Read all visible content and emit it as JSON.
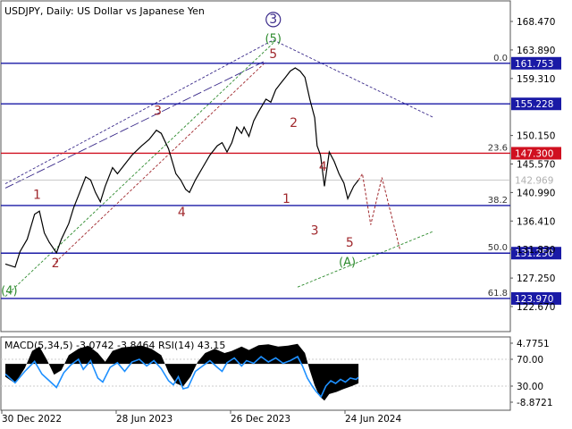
{
  "chart_data": {
    "type": "line",
    "title": "USDJPY, Daily:  US Dollar vs Japanese Yen",
    "symbol": "USDJPY",
    "timeframe": "Daily",
    "description": "US Dollar vs Japanese Yen",
    "x_ticks": [
      "30 Dec 2022",
      "28 Jun 2023",
      "26 Dec 2023",
      "24 Jun 2024"
    ],
    "y_ticks": [
      "168.470",
      "163.890",
      "159.310",
      "150.150",
      "145.570",
      "140.990",
      "136.410",
      "131.830",
      "127.250",
      "122.670"
    ],
    "ylim": [
      121.5,
      170.5
    ],
    "price_path": [
      [
        0.0,
        129.5
      ],
      [
        2.0,
        129.0
      ],
      [
        3.0,
        131.5
      ],
      [
        4.5,
        133.5
      ],
      [
        6.0,
        137.5
      ],
      [
        7.0,
        138.0
      ],
      [
        8.0,
        134.5
      ],
      [
        9.0,
        133.0
      ],
      [
        10.5,
        131.3
      ],
      [
        11.5,
        133.5
      ],
      [
        13.0,
        136.0
      ],
      [
        14.0,
        138.5
      ],
      [
        15.0,
        140.5
      ],
      [
        16.5,
        143.5
      ],
      [
        17.5,
        143.0
      ],
      [
        18.5,
        141.0
      ],
      [
        19.5,
        139.5
      ],
      [
        20.5,
        142.0
      ],
      [
        22.0,
        145.0
      ],
      [
        23.0,
        144.0
      ],
      [
        24.5,
        145.5
      ],
      [
        26.0,
        147.0
      ],
      [
        28.0,
        148.5
      ],
      [
        29.5,
        149.5
      ],
      [
        31.0,
        151.0
      ],
      [
        32.0,
        150.5
      ],
      [
        33.5,
        148.0
      ],
      [
        35.0,
        144.0
      ],
      [
        36.0,
        143.0
      ],
      [
        37.0,
        141.5
      ],
      [
        37.8,
        141.0
      ],
      [
        39.0,
        143.0
      ],
      [
        40.5,
        145.0
      ],
      [
        42.0,
        147.0
      ],
      [
        43.5,
        148.5
      ],
      [
        44.5,
        149.0
      ],
      [
        45.5,
        147.5
      ],
      [
        46.5,
        149.0
      ],
      [
        47.5,
        151.5
      ],
      [
        48.5,
        150.5
      ],
      [
        49.0,
        151.5
      ],
      [
        50.0,
        150.0
      ],
      [
        51.0,
        152.5
      ],
      [
        52.0,
        154.0
      ],
      [
        53.5,
        156.0
      ],
      [
        54.5,
        155.5
      ],
      [
        55.5,
        157.5
      ],
      [
        56.5,
        158.5
      ],
      [
        57.5,
        159.5
      ],
      [
        58.5,
        160.5
      ],
      [
        59.5,
        161.0
      ],
      [
        60.5,
        160.5
      ],
      [
        61.5,
        159.5
      ],
      [
        62.5,
        156.0
      ],
      [
        63.5,
        153.0
      ],
      [
        64.0,
        148.5
      ],
      [
        64.7,
        147.0
      ],
      [
        65.5,
        142.0
      ],
      [
        66.5,
        147.5
      ],
      [
        67.5,
        146.0
      ],
      [
        68.5,
        144.0
      ],
      [
        69.5,
        142.5
      ],
      [
        70.3,
        140.0
      ],
      [
        71.5,
        142.0
      ],
      [
        72.5,
        143.0
      ]
    ],
    "horizontal_levels": [
      {
        "price": 161.753,
        "label": "161.753",
        "fib": "0.0",
        "color": "#1a1aa6"
      },
      {
        "price": 155.228,
        "label": "155.228",
        "fib": "",
        "color": "#1a1aa6"
      },
      {
        "price": 147.3,
        "label": "147.300",
        "fib": "23.6",
        "color": "#d01020"
      },
      {
        "price": 142.969,
        "label": "142.969",
        "fib": "",
        "color": "#b8b8b8"
      },
      {
        "price": 138.9,
        "label": "",
        "fib": "38.2",
        "color": "#1a1aa6"
      },
      {
        "price": 131.25,
        "label": "131.250",
        "fib": "50.0",
        "color": "#1a1aa6"
      },
      {
        "price": 123.97,
        "label": "123.970",
        "fib": "61.8",
        "color": "#1a1aa6"
      }
    ],
    "wave_labels": [
      {
        "text": "(4)",
        "x": 0.8,
        "y": 124.6,
        "color": "#2e8b2e"
      },
      {
        "text": "1",
        "x": 6.5,
        "y": 140.0,
        "color": "#a0282d"
      },
      {
        "text": "2",
        "x": 10.3,
        "y": 129.0,
        "color": "#a0282d"
      },
      {
        "text": "3",
        "x": 31.3,
        "y": 153.5,
        "color": "#a0282d"
      },
      {
        "text": "4",
        "x": 36.2,
        "y": 137.2,
        "color": "#a0282d"
      },
      {
        "text": "5",
        "x": 55.0,
        "y": 162.6,
        "color": "#a0282d"
      },
      {
        "text": "(5)",
        "x": 55.0,
        "y": 165.1,
        "color": "#2e8b2e"
      },
      {
        "text": "3",
        "x": 55.0,
        "y": 168.2,
        "color": "#3a2a8a",
        "circled": true
      },
      {
        "text": "2",
        "x": 59.2,
        "y": 151.5,
        "color": "#a0282d"
      },
      {
        "text": "1",
        "x": 57.7,
        "y": 139.3,
        "color": "#a0282d"
      },
      {
        "text": "4",
        "x": 65.2,
        "y": 144.5,
        "color": "#a0282d"
      },
      {
        "text": "3",
        "x": 63.5,
        "y": 134.2,
        "color": "#a0282d"
      },
      {
        "text": "5",
        "x": 70.7,
        "y": 132.3,
        "color": "#a0282d"
      },
      {
        "text": "(A)",
        "x": 70.2,
        "y": 129.2,
        "color": "#2e8b2e"
      }
    ],
    "forecast_path": [
      [
        72.5,
        142.969
      ],
      [
        73.3,
        144.0
      ],
      [
        75.0,
        135.8
      ],
      [
        77.3,
        143.4
      ],
      [
        81.0,
        131.9
      ]
    ],
    "trend_lines": [
      {
        "from": [
          0.0,
          142.4
        ],
        "to": [
          55.0,
          165.5
        ],
        "color": "#3a2a8a",
        "dash": "3,2"
      },
      {
        "from": [
          0.0,
          141.7
        ],
        "to": [
          53.0,
          162.0
        ],
        "color": "#3a2a8a",
        "dash": "10,3"
      },
      {
        "from": [
          55.0,
          165.5
        ],
        "to": [
          88.0,
          153.0
        ],
        "color": "#3a2a8a",
        "dash": "3,2"
      },
      {
        "from": [
          0.0,
          124.3
        ],
        "to": [
          55.0,
          165.0
        ],
        "color": "#2e8b2e",
        "dash": "3,2"
      },
      {
        "from": [
          60.0,
          125.8
        ],
        "to": [
          88.0,
          134.8
        ],
        "color": "#2e8b2e",
        "dash": "3,2"
      },
      {
        "from": [
          10.3,
          129.8
        ],
        "to": [
          53.5,
          162.0
        ],
        "color": "#a0282d",
        "dash": "3,2"
      }
    ],
    "indicator": {
      "label": "MACD(5,34,5) -3.0742 -3.8464 RSI(14) 43.15",
      "name": "MACD(5,34,5)",
      "macd_main": -3.0742,
      "macd_signal": -3.8464,
      "rsi_period": 14,
      "rsi_value": 43.15,
      "y_ticks": [
        "4.7751",
        "70.00",
        "30.00",
        "-8.8721"
      ],
      "rsi_path": [
        [
          0.0,
          48
        ],
        [
          2.0,
          35
        ],
        [
          4.0,
          52
        ],
        [
          6.0,
          67
        ],
        [
          7.5,
          48
        ],
        [
          9.0,
          38
        ],
        [
          10.5,
          28
        ],
        [
          12.0,
          50
        ],
        [
          13.5,
          62
        ],
        [
          15.0,
          70
        ],
        [
          16.0,
          55
        ],
        [
          17.5,
          68
        ],
        [
          19.0,
          42
        ],
        [
          20.0,
          36
        ],
        [
          21.5,
          58
        ],
        [
          23.0,
          65
        ],
        [
          24.5,
          52
        ],
        [
          26.0,
          66
        ],
        [
          27.5,
          70
        ],
        [
          29.0,
          60
        ],
        [
          30.5,
          68
        ],
        [
          32.0,
          56
        ],
        [
          33.5,
          38
        ],
        [
          34.5,
          32
        ],
        [
          35.5,
          44
        ],
        [
          36.5,
          26
        ],
        [
          37.5,
          28
        ],
        [
          39.0,
          52
        ],
        [
          40.5,
          60
        ],
        [
          42.0,
          68
        ],
        [
          43.5,
          58
        ],
        [
          44.5,
          52
        ],
        [
          45.5,
          65
        ],
        [
          47.0,
          72
        ],
        [
          48.5,
          60
        ],
        [
          49.5,
          68
        ],
        [
          51.0,
          64
        ],
        [
          52.5,
          74
        ],
        [
          54.0,
          66
        ],
        [
          55.5,
          72
        ],
        [
          57.0,
          64
        ],
        [
          58.5,
          68
        ],
        [
          60.0,
          74
        ],
        [
          61.0,
          60
        ],
        [
          62.0,
          42
        ],
        [
          63.0,
          30
        ],
        [
          63.8,
          22
        ],
        [
          64.8,
          14
        ],
        [
          65.8,
          30
        ],
        [
          66.8,
          38
        ],
        [
          67.8,
          34
        ],
        [
          68.8,
          40
        ],
        [
          69.8,
          36
        ],
        [
          70.8,
          42
        ],
        [
          72.0,
          40
        ],
        [
          72.5,
          43
        ]
      ],
      "macd_hist_path": [
        [
          0.0,
          -3.0
        ],
        [
          2.0,
          -4.5
        ],
        [
          4.0,
          -1.0
        ],
        [
          5.5,
          3.0
        ],
        [
          7.0,
          4.0
        ],
        [
          8.5,
          1.0
        ],
        [
          10.0,
          -2.5
        ],
        [
          11.5,
          -1.5
        ],
        [
          13.0,
          2.0
        ],
        [
          15.0,
          3.5
        ],
        [
          17.0,
          4.2
        ],
        [
          19.0,
          2.5
        ],
        [
          20.5,
          0.5
        ],
        [
          22.0,
          3.0
        ],
        [
          24.0,
          3.8
        ],
        [
          26.0,
          4.0
        ],
        [
          28.0,
          4.2
        ],
        [
          30.0,
          3.5
        ],
        [
          32.0,
          2.0
        ],
        [
          33.5,
          -2.0
        ],
        [
          35.0,
          -4.5
        ],
        [
          36.5,
          -5.2
        ],
        [
          38.0,
          -3.0
        ],
        [
          39.5,
          0.5
        ],
        [
          41.0,
          2.5
        ],
        [
          43.0,
          3.5
        ],
        [
          45.0,
          2.5
        ],
        [
          46.5,
          3.0
        ],
        [
          48.5,
          4.0
        ],
        [
          50.0,
          3.2
        ],
        [
          52.0,
          4.3
        ],
        [
          54.0,
          4.5
        ],
        [
          56.0,
          4.0
        ],
        [
          58.0,
          4.2
        ],
        [
          60.0,
          4.6
        ],
        [
          61.5,
          2.5
        ],
        [
          62.5,
          -1.5
        ],
        [
          63.5,
          -5.0
        ],
        [
          64.5,
          -7.5
        ],
        [
          65.5,
          -8.5
        ],
        [
          66.5,
          -7.0
        ],
        [
          68.0,
          -6.5
        ],
        [
          69.5,
          -5.8
        ],
        [
          71.0,
          -5.2
        ],
        [
          72.5,
          -4.5
        ]
      ]
    },
    "colors": {
      "price": "#000000",
      "level_blue": "#1a1aa6",
      "level_red": "#d01020",
      "wave_red": "#a0282d",
      "wave_green": "#2e8b2e",
      "wave_purple": "#3a2a8a",
      "rsi": "#1e90ff",
      "macd_hist": "#000000",
      "grid": "#cccccc"
    }
  }
}
